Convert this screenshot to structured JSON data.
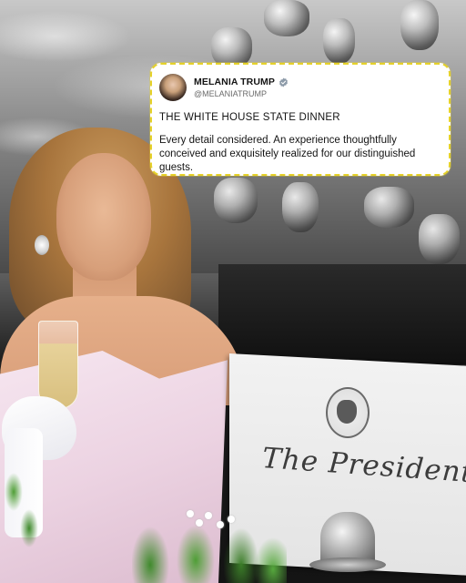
{
  "post": {
    "author_name": "MELANIA TRUMP",
    "author_handle": "@MELANIATRUMP",
    "verified": true,
    "headline": "THE WHITE HOUSE STATE DINNER",
    "body": "Every detail considered. An experience thoughtfully conceived and exquisitely realized for our distinguished guests.",
    "highlight_color": "#e6d22a",
    "verified_color": "#8c9aa8"
  },
  "place_card": {
    "name": "The President"
  }
}
